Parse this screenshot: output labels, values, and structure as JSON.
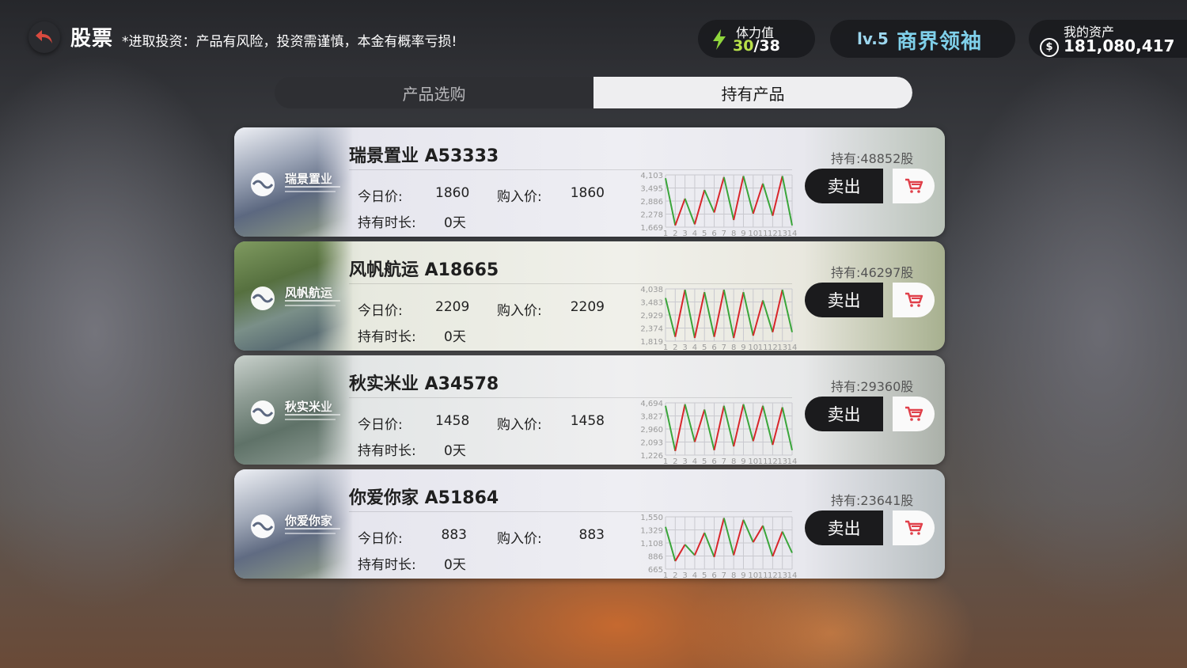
{
  "header": {
    "title": "股票",
    "risk_note": "*进取投资：产品有风险，投资需谨慎，本金有概率亏损!",
    "stamina_label": "体力值",
    "stamina_current": "30",
    "stamina_max": "/38",
    "level": "lv.5",
    "rank": "商界领袖",
    "assets_label": "我的资产",
    "assets_value": "181,080,417",
    "coin_symbol": "$"
  },
  "tabs": [
    {
      "label": "产品选购",
      "active": false
    },
    {
      "label": "持有产品",
      "active": true
    }
  ],
  "labels": {
    "today_price": "今日价:",
    "buy_price": "购入价:",
    "hold_duration": "持有时长:",
    "sell": "卖出"
  },
  "colors": {
    "up": "#d8262b",
    "down": "#3aa53a",
    "grid": "#c9c9cf",
    "accent_level": "#7fd0ea",
    "accent_stamina": "#b8e04a"
  },
  "icons": [
    "back-arrow-icon",
    "lightning-icon",
    "coin-icon",
    "cart-icon"
  ],
  "stocks": [
    {
      "name": "瑞景置业 A53333",
      "logo_text": "瑞景置业",
      "today_price": "1860",
      "buy_price": "1860",
      "duration": "0天",
      "holding": "持有:48852股"
    },
    {
      "name": "风帆航运 A18665",
      "logo_text": "风帆航运",
      "today_price": "2209",
      "buy_price": "2209",
      "duration": "0天",
      "holding": "持有:46297股"
    },
    {
      "name": "秋实米业 A34578",
      "logo_text": "秋实米业",
      "today_price": "1458",
      "buy_price": "1458",
      "duration": "0天",
      "holding": "持有:29360股"
    },
    {
      "name": "你爱你家 A51864",
      "logo_text": "你爱你家",
      "today_price": "883",
      "buy_price": "883",
      "duration": "0天",
      "holding": "持有:23641股"
    }
  ],
  "chart_data": [
    {
      "type": "line",
      "x": [
        1,
        2,
        3,
        4,
        5,
        6,
        7,
        8,
        9,
        10,
        11,
        12,
        13,
        14
      ],
      "yticks": [
        "1,669",
        "2,278",
        "2,886",
        "3,495",
        "4,103"
      ],
      "ylim": [
        1669,
        4103
      ],
      "values": [
        3950,
        1750,
        3000,
        1800,
        3400,
        2350,
        4000,
        2000,
        4050,
        2300,
        3700,
        2200,
        4050,
        1750
      ]
    },
    {
      "type": "line",
      "x": [
        1,
        2,
        3,
        4,
        5,
        6,
        7,
        8,
        9,
        10,
        11,
        12,
        13,
        14
      ],
      "yticks": [
        "1,819",
        "2,374",
        "2,929",
        "3,483",
        "4,038"
      ],
      "ylim": [
        1819,
        4038
      ],
      "values": [
        3650,
        2000,
        4000,
        1950,
        3900,
        2000,
        4000,
        1950,
        3900,
        2050,
        3550,
        2200,
        4000,
        2200
      ]
    },
    {
      "type": "line",
      "x": [
        1,
        2,
        3,
        4,
        5,
        6,
        7,
        8,
        9,
        10,
        11,
        12,
        13,
        14
      ],
      "yticks": [
        "1,226",
        "2,093",
        "2,960",
        "3,827",
        "4,694"
      ],
      "ylim": [
        1226,
        4694
      ],
      "values": [
        4500,
        1500,
        4600,
        2100,
        4250,
        1550,
        4500,
        1800,
        4600,
        2150,
        4500,
        1900,
        4400,
        1550
      ]
    },
    {
      "type": "line",
      "x": [
        1,
        2,
        3,
        4,
        5,
        6,
        7,
        8,
        9,
        10,
        11,
        12,
        13,
        14
      ],
      "yticks": [
        "665",
        "886",
        "1,108",
        "1,329",
        "1,550"
      ],
      "ylim": [
        665,
        1550
      ],
      "values": [
        1380,
        800,
        1080,
        900,
        1280,
        870,
        1530,
        900,
        1500,
        1120,
        1400,
        880,
        1300,
        940
      ]
    }
  ]
}
